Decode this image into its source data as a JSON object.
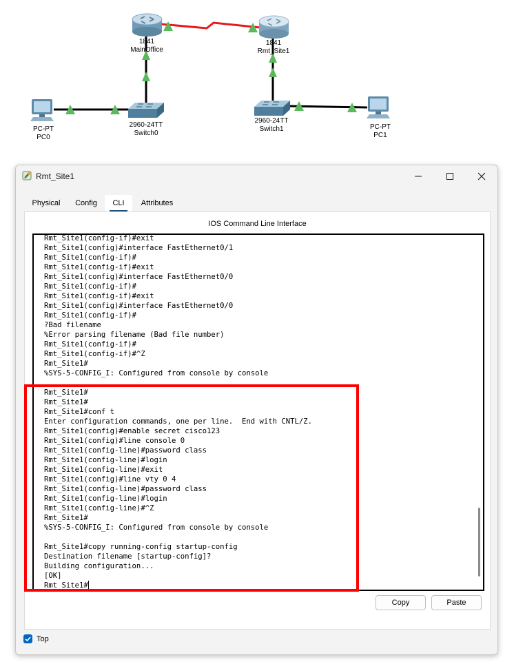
{
  "topology": {
    "devices": [
      {
        "id": "main-office",
        "model": "1841",
        "name": "MainOffice",
        "type": "router"
      },
      {
        "id": "rmt-site1",
        "model": "1841",
        "name": "Rmt_Site1",
        "type": "router"
      },
      {
        "id": "switch0",
        "model": "2960-24TT",
        "name": "Switch0",
        "type": "switch"
      },
      {
        "id": "switch1",
        "model": "2960-24TT",
        "name": "Switch1",
        "type": "switch"
      },
      {
        "id": "pc0",
        "model": "PC-PT",
        "name": "PC0",
        "type": "pc"
      },
      {
        "id": "pc1",
        "model": "PC-PT",
        "name": "PC1",
        "type": "pc"
      }
    ],
    "link_colors": {
      "serial": "#e8191a",
      "ethernet": "#000000",
      "port_up": "#5cb85c"
    }
  },
  "window": {
    "title": "Rmt_Site1",
    "controls": {
      "minimize": "minimize-icon",
      "maximize": "maximize-icon",
      "close": "close-icon"
    },
    "tabs": [
      {
        "label": "Physical",
        "active": false
      },
      {
        "label": "Config",
        "active": false
      },
      {
        "label": "CLI",
        "active": true
      },
      {
        "label": "Attributes",
        "active": false
      }
    ],
    "panel_title": "IOS Command Line Interface",
    "terminal_lines": [
      "Rmt_Site1(config-if)#exit",
      "Rmt_Site1(config)#interface FastEthernet0/1",
      "Rmt_Site1(config-if)#",
      "Rmt_Site1(config-if)#exit",
      "Rmt_Site1(config)#interface FastEthernet0/0",
      "Rmt_Site1(config-if)#",
      "Rmt_Site1(config-if)#exit",
      "Rmt_Site1(config)#interface FastEthernet0/0",
      "Rmt_Site1(config-if)#",
      "?Bad filename",
      "%Error parsing filename (Bad file number)",
      "Rmt_Site1(config-if)#",
      "Rmt_Site1(config-if)#^Z",
      "Rmt_Site1#",
      "%SYS-5-CONFIG_I: Configured from console by console",
      "",
      "Rmt_Site1#",
      "Rmt_Site1#",
      "Rmt_Site1#conf t",
      "Enter configuration commands, one per line.  End with CNTL/Z.",
      "Rmt_Site1(config)#enable secret cisco123",
      "Rmt_Site1(config)#line console 0",
      "Rmt_Site1(config-line)#password class",
      "Rmt_Site1(config-line)#login",
      "Rmt_Site1(config-line)#exit",
      "Rmt_Site1(config)#line vty 0 4",
      "Rmt_Site1(config-line)#password class",
      "Rmt_Site1(config-line)#login",
      "Rmt_Site1(config-line)#^Z",
      "Rmt_Site1#",
      "%SYS-5-CONFIG_I: Configured from console by console",
      "",
      "Rmt_Site1#copy running-config startup-config",
      "Destination filename [startup-config]?",
      "Building configuration...",
      "[OK]",
      "Rmt_Site1#"
    ],
    "buttons": {
      "copy": "Copy",
      "paste": "Paste"
    },
    "top_checkbox": {
      "label": "Top",
      "checked": true
    },
    "highlight_color": "#ff0000"
  }
}
